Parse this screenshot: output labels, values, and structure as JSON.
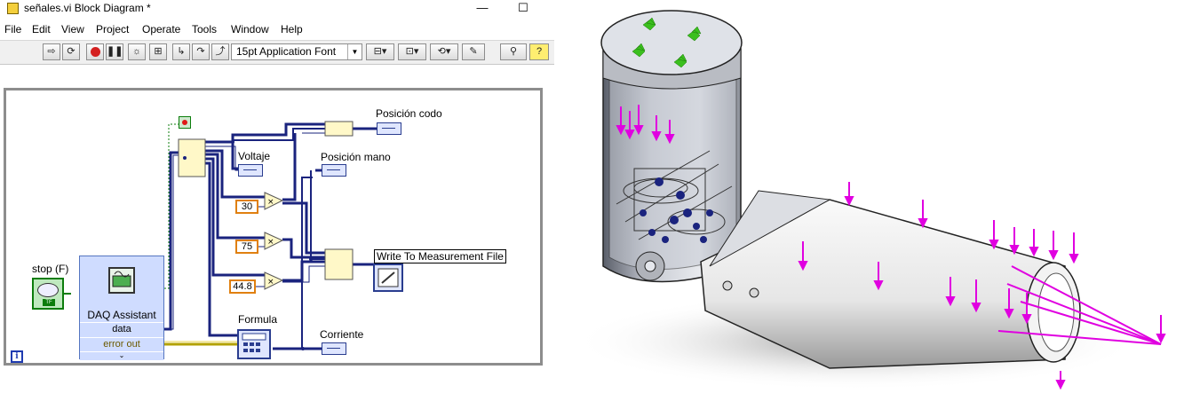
{
  "window": {
    "title": "señales.vi Block Diagram *",
    "minimize": "—",
    "maximize": "☐"
  },
  "menu": [
    "File",
    "Edit",
    "View",
    "Project",
    "Operate",
    "Tools",
    "Window",
    "Help"
  ],
  "toolbar": {
    "font_selector": "15pt Application Font"
  },
  "diagram": {
    "labels": {
      "posicion_codo": "Posición codo",
      "voltaje": "Voltaje",
      "posicion_mano": "Posición mano",
      "write_file": "Write To Measurement File",
      "stop": "stop (F)",
      "formula": "Formula",
      "corriente": "Corriente"
    },
    "constants": [
      "30",
      "75",
      "44.8"
    ],
    "daq": {
      "title": "DAQ Assistant",
      "data": "data",
      "error_out": "error out"
    },
    "stop_tf": "TF",
    "info_icon": "i"
  },
  "colors": {
    "wire_dynamic": "#1a237e",
    "wire_error": "#b3a100",
    "wire_bool": "#0c7d0c",
    "constant_border": "#e08010",
    "indicator_blue": "#2a3d8f",
    "arrow_magenta": "#e000e0",
    "leaf_green": "#3bbf1e"
  }
}
